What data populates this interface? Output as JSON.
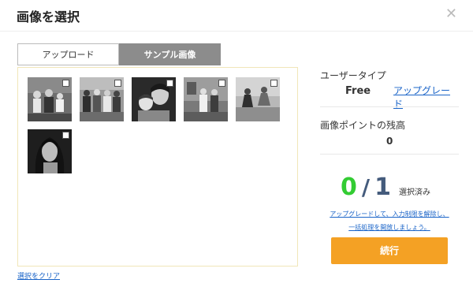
{
  "dialog": {
    "title": "画像を選択",
    "close_icon": "close-icon"
  },
  "tabs": [
    {
      "label": "アップロード",
      "active": false
    },
    {
      "label": "サンプル画像",
      "active": true
    }
  ],
  "sample_images": [
    {
      "name": "family-photo-1",
      "checked": false
    },
    {
      "name": "group-photo",
      "checked": false
    },
    {
      "name": "mother-child-portrait",
      "checked": false
    },
    {
      "name": "two-people-room",
      "checked": false
    },
    {
      "name": "children-playing",
      "checked": false
    },
    {
      "name": "woman-portrait",
      "checked": false
    }
  ],
  "clear_selection": "選択をクリア",
  "sidebar": {
    "user_type_label": "ユーザータイプ",
    "user_type_value": "Free",
    "upgrade_link": "アップグレード",
    "points_label": "画像ポイントの残高",
    "points_value": "0",
    "selected_count": "0",
    "max_count": "1",
    "slash": "/",
    "selected_suffix": "選択済み",
    "upgrade_message_line1": "アップグレードして、入力制限を解除し、",
    "upgrade_message_line2": "一括処理を開放しましょう。",
    "continue_button": "続行"
  },
  "colors": {
    "accent_orange": "#f4a124",
    "count_green": "#33cc33",
    "count_navy": "#445b7c",
    "link_blue": "#1a64c8"
  }
}
